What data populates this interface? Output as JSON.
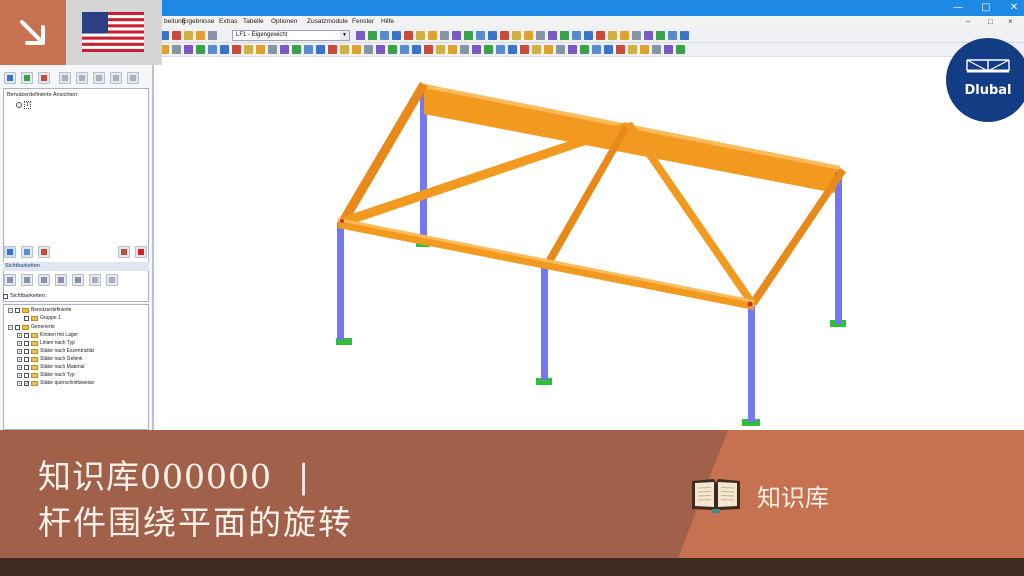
{
  "window": {
    "minimize_glyph": "—",
    "maximize_glyph": "□",
    "close_glyph": "✕"
  },
  "menu": {
    "items": [
      "beitung",
      "Ergebnisse",
      "Extras",
      "Tabelle",
      "Optionen",
      "Zusatzmodule",
      "Fenster",
      "Hilfe"
    ],
    "mdi_controls": [
      "–",
      "□",
      "×"
    ]
  },
  "toolbar": {
    "load_case_combo": "LF1 - Eigengewicht"
  },
  "navigator": {
    "views_label": "Benutzerdefinierte Ansichten:",
    "views_item": "1",
    "visibility_header": "Sichtbarkeiten",
    "visibility_checkbox_label": "Sichtbarkeiten:",
    "tree": [
      {
        "label": "Benutzerdefinierte",
        "level": 0,
        "checked": false
      },
      {
        "label": "Gruppe 1",
        "level": 1,
        "checked": false
      },
      {
        "label": "Generierte",
        "level": 0,
        "checked": false
      },
      {
        "label": "Knoten mit Lager",
        "level": 1,
        "checked": false
      },
      {
        "label": "Linien nach Typ",
        "level": 1,
        "checked": false
      },
      {
        "label": "Stäbe nach Exzentrizität",
        "level": 1,
        "checked": false
      },
      {
        "label": "Stäbe nach Gelenk",
        "level": 1,
        "checked": false
      },
      {
        "label": "Stäbe nach Material",
        "level": 1,
        "checked": false
      },
      {
        "label": "Stäbe nach Typ",
        "level": 1,
        "checked": false
      },
      {
        "label": "Stäbe querschnittsweise",
        "level": 1,
        "checked": true
      }
    ]
  },
  "colors": {
    "beam": "#f29a1f",
    "column": "#7477f2",
    "support": "#2fbf3a",
    "banner": "#a0604a",
    "banner_accent": "#c6714f",
    "logo": "#123c84"
  },
  "logo": {
    "text": "Dlubal"
  },
  "banner": {
    "title_code": "知识库000000",
    "title_separator": "|",
    "subtitle": "杆件围绕平面的旋转",
    "kb_label": "知识库"
  }
}
